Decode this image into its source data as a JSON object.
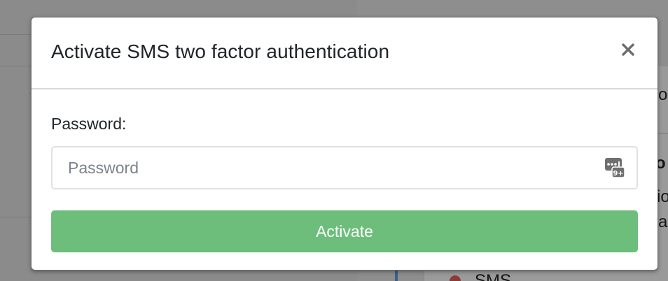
{
  "modal": {
    "title": "Activate SMS two factor authentication",
    "close_icon": "close-icon",
    "password_label": "Password:",
    "password_input": {
      "value": "",
      "placeholder": "Password"
    },
    "password_manager_icon": "password-manager-icon",
    "activate_label": "Activate"
  },
  "background": {
    "fragment_right_1": "o",
    "fragment_right_2": "o",
    "fragment_right_3": "io",
    "fragment_right_4": "a",
    "fragment_bottom": "SMS"
  },
  "colors": {
    "activate_button": "#6dbd7b",
    "overlay": "#8f8f8f"
  }
}
